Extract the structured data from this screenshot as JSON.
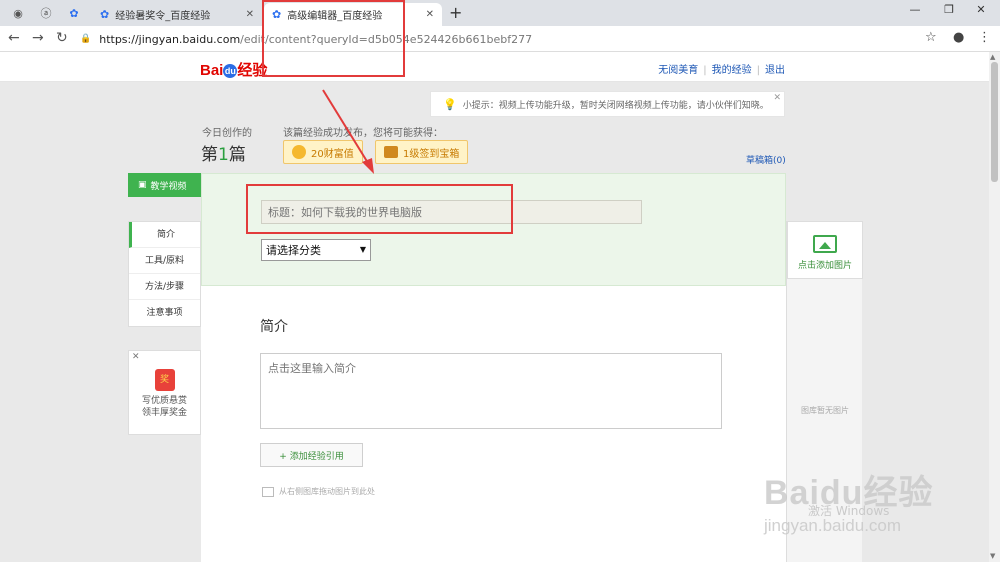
{
  "browser": {
    "tabs": [
      {
        "label": "经验暑奖令_百度经验",
        "active": false
      },
      {
        "label": "高级编辑器_百度经验",
        "active": true
      }
    ],
    "url_host": "https://jingyan.baidu.com",
    "url_path": "/edit/content?queryId=d5b054e524426b661bebf277"
  },
  "header": {
    "logo_text": "Bai",
    "logo_du": "du",
    "logo_suffix": "经验",
    "links": [
      "无阅美育",
      "我的经验",
      "退出"
    ]
  },
  "tip": {
    "text": "小提示：视频上传功能升级，暂时关闭网络视频上传功能，请小伙伴们知晓。"
  },
  "stats": {
    "today_label": "今日创作的",
    "count_prefix": "第",
    "count_num": "1",
    "count_suffix": "篇",
    "reward_label": "该篇经验成功发布，您将可能获得：",
    "reward_1": "20财富值",
    "reward_2": "1级签到宝箱",
    "drafts": "草稿箱(0)"
  },
  "sidebar": {
    "video_btn": "教学视频",
    "items": [
      "简介",
      "工具/原料",
      "方法/步骤",
      "注意事项"
    ],
    "promo_badge": "奖",
    "promo_line1": "写优质悬赏",
    "promo_line2": "领丰厚奖金"
  },
  "editor": {
    "title_placeholder": "标题：如何下载我的世界电脑版",
    "category_selected": "请选择分类",
    "section_title": "简介",
    "intro_placeholder": "点击这里输入简介",
    "add_ref": "+ 添加经验引用",
    "drag_hint": "从右侧图库拖动图片到此处"
  },
  "right_panel": {
    "add_image": "点击添加图片",
    "gallery_empty": "图库暂无图片"
  },
  "watermarks": {
    "activate": "激活 Windows",
    "brand": "Baidu经验",
    "brand_url": "jingyan.baidu.com"
  },
  "colors": {
    "accent_green": "#3fb34f",
    "annotation_red": "#e23b3b",
    "link_blue": "#1d57b5"
  }
}
